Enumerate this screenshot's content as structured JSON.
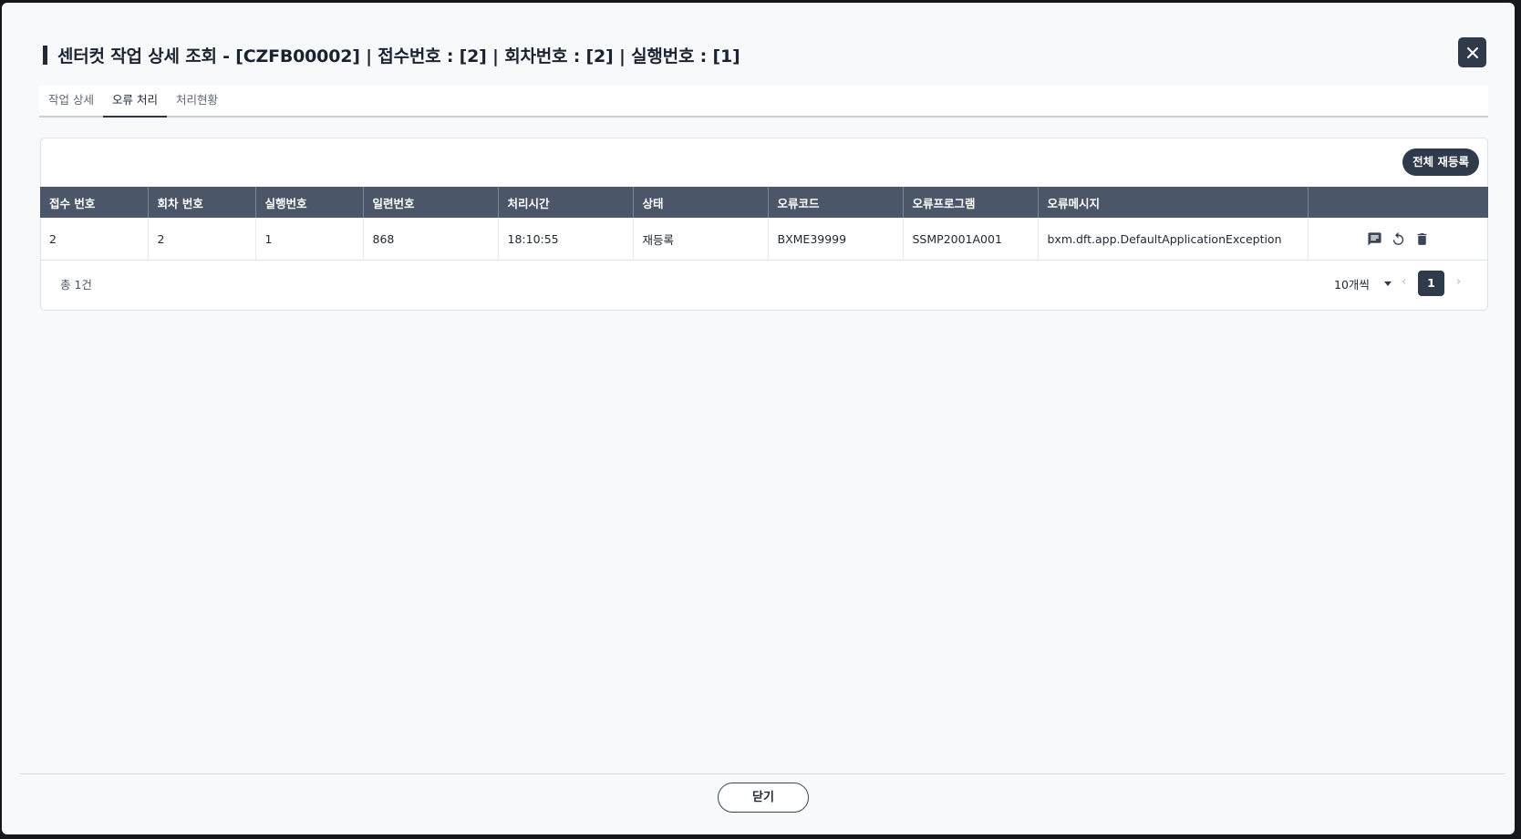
{
  "dialog": {
    "title": "센터컷 작업 상세 조회 - [CZFB00002] | 접수번호 : [2] | 회차번호 : [2] | 실행번호 : [1]",
    "close_icon": "close-icon"
  },
  "tabs": [
    {
      "label": "작업 상세",
      "active": false
    },
    {
      "label": "오류 처리",
      "active": true
    },
    {
      "label": "처리현황",
      "active": false
    }
  ],
  "toolbar": {
    "reregister_all_label": "전체 재등록"
  },
  "table": {
    "columns": [
      "접수 번호",
      "회차 번호",
      "실행번호",
      "일련번호",
      "처리시간",
      "상태",
      "오류코드",
      "오류프로그램",
      "오류메시지",
      ""
    ],
    "rows": [
      {
        "receipt_no": "2",
        "round_no": "2",
        "exec_no": "1",
        "serial_no": "868",
        "time": "18:10:55",
        "status": "재등록",
        "error_code": "BXME39999",
        "error_program": "SSMP2001A001",
        "error_message": "bxm.dft.app.DefaultApplicationException",
        "actions": [
          "message-icon",
          "refresh-icon",
          "trash-icon"
        ]
      }
    ]
  },
  "footer": {
    "total_text": "총 1건",
    "page_size": "10개씩",
    "current_page": "1",
    "prev": "‹",
    "next": "›"
  },
  "bottom": {
    "close_label": "닫기"
  },
  "colors": {
    "header_bg": "#4b5668",
    "primary_dark": "#2f3a4b",
    "page_bg": "#f7f9fb"
  }
}
